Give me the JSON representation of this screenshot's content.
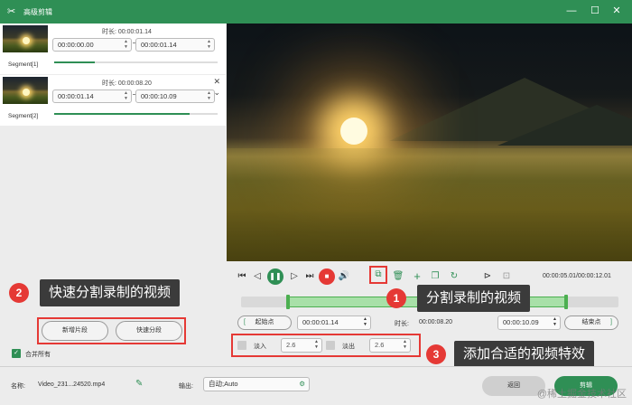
{
  "colors": {
    "brand": "#2f8f55",
    "accent_red": "#e53935",
    "callout_bg": "#3b3b3b"
  },
  "window": {
    "title": "高级剪辑",
    "minimize": "—",
    "maximize": "☐",
    "close": "✕"
  },
  "segments": [
    {
      "label": "Segment[1]",
      "duration_label": "时长: 00:00:01.14",
      "start": "00:00:00.00",
      "end": "00:00:01.14",
      "progress": 0.25
    },
    {
      "label": "Segment[2]",
      "duration_label": "时长: 00:00:08.20",
      "start": "00:00:01.14",
      "end": "00:00:10.09",
      "progress": 0.83
    }
  ],
  "player": {
    "time_readout": "00:00:05.01/00:00:12.01",
    "start_point_label": "起始点",
    "start_time": "00:00:01.14",
    "duration_label": "时长:",
    "duration": "00:00:08.20",
    "end_time": "00:00:10.09",
    "end_point_label": "结束点",
    "selection": {
      "start": 0.125,
      "end": 0.86
    }
  },
  "effects": {
    "fade_in_label": "淡入",
    "fade_in_value": "2.6",
    "fade_out_label": "淡出",
    "fade_out_value": "2.6"
  },
  "left_actions": {
    "new_segment": "新增片段",
    "quick_split": "快速分段",
    "merge_all": "合并所有"
  },
  "callouts": [
    {
      "number": "1",
      "text": "分割录制的视频"
    },
    {
      "number": "2",
      "text": "快速分割录制的视频"
    },
    {
      "number": "3",
      "text": "添加合适的视频特效"
    }
  ],
  "bottom": {
    "name_label": "名称:",
    "file_name": "Video_231...24520.mp4",
    "output_label": "输出:",
    "output_value": "自动;Auto",
    "back_button": "返回",
    "clip_button": "剪辑"
  },
  "watermark": "@稀土掘金技术社区"
}
